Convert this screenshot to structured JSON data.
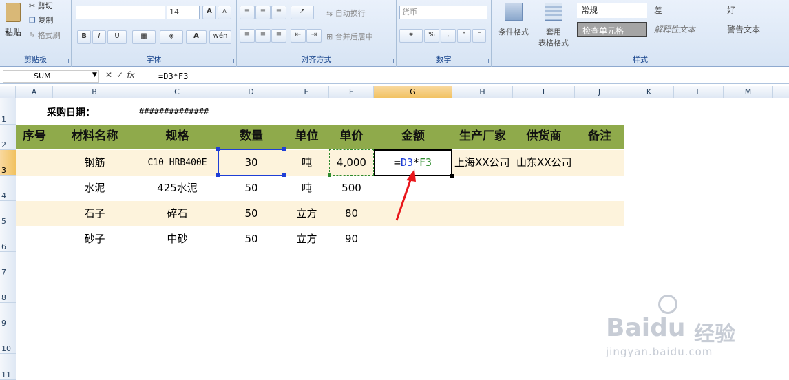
{
  "ribbon": {
    "clipboard": {
      "paste": "粘贴",
      "cut": "剪切",
      "copy": "复制",
      "format_painter": "格式刷",
      "label": "剪贴板"
    },
    "font": {
      "font_name": "",
      "font_size": "14",
      "grow": "A",
      "shrink": "A",
      "bold": "B",
      "italic": "I",
      "underline": "U",
      "label": "字体"
    },
    "alignment": {
      "wrap_text": "自动换行",
      "merge_center": "合并后居中",
      "label": "对齐方式"
    },
    "number": {
      "format": "货币",
      "percent": "%",
      "comma": ",",
      "label": "数字"
    },
    "styles": {
      "conditional": "条件格式",
      "table_format": "套用",
      "table_format2": "表格格式",
      "normal": "常规",
      "bad": "差",
      "good": "好",
      "check_cell": "检查单元格",
      "explanatory": "解释性文本",
      "warning": "警告文本",
      "label": "样式"
    }
  },
  "formula_bar": {
    "name_box": "SUM",
    "cancel": "✕",
    "enter": "✓",
    "fx": "fx",
    "formula": "=D3*F3"
  },
  "columns": [
    "A",
    "B",
    "C",
    "D",
    "E",
    "F",
    "G",
    "H",
    "I",
    "J",
    "K",
    "L",
    "M"
  ],
  "rows": [
    "1",
    "2",
    "3",
    "4",
    "5",
    "6",
    "7",
    "8",
    "9",
    "10",
    "11"
  ],
  "sheet": {
    "purchase_date_label": "采购日期：",
    "purchase_date_value": "##############",
    "headers": [
      "序号",
      "材料名称",
      "规格",
      "数量",
      "单位",
      "单价",
      "金额",
      "生产厂家",
      "供货商",
      "备注"
    ],
    "data_rows": [
      {
        "name": "钢筋",
        "spec": "C10 HRB400E",
        "qty": "30",
        "unit": "吨",
        "price": "4,000",
        "maker": "上海XX公司",
        "supplier": "山东XX公司"
      },
      {
        "name": "水泥",
        "spec": "425水泥",
        "qty": "50",
        "unit": "吨",
        "price": "500",
        "maker": "",
        "supplier": ""
      },
      {
        "name": "石子",
        "spec": "碎石",
        "qty": "50",
        "unit": "立方",
        "price": "80",
        "maker": "",
        "supplier": ""
      },
      {
        "name": "砂子",
        "spec": "中砂",
        "qty": "50",
        "unit": "立方",
        "price": "90",
        "maker": "",
        "supplier": ""
      }
    ],
    "edit_formula": {
      "eq": "=",
      "ref1": "D3",
      "op": "*",
      "ref2": "F3"
    }
  },
  "watermark": {
    "brand": "Bai",
    "brand2": "du",
    "cn": "经验",
    "url": "jingyan.baidu.com"
  },
  "colors": {
    "header_band": "#8faa4b",
    "stripe": "#fdf3dc",
    "ref1": "#1f3fd6",
    "ref2": "#2e8b2e",
    "arrow": "#e8161b",
    "selected_hdr": "#f4c86a"
  }
}
